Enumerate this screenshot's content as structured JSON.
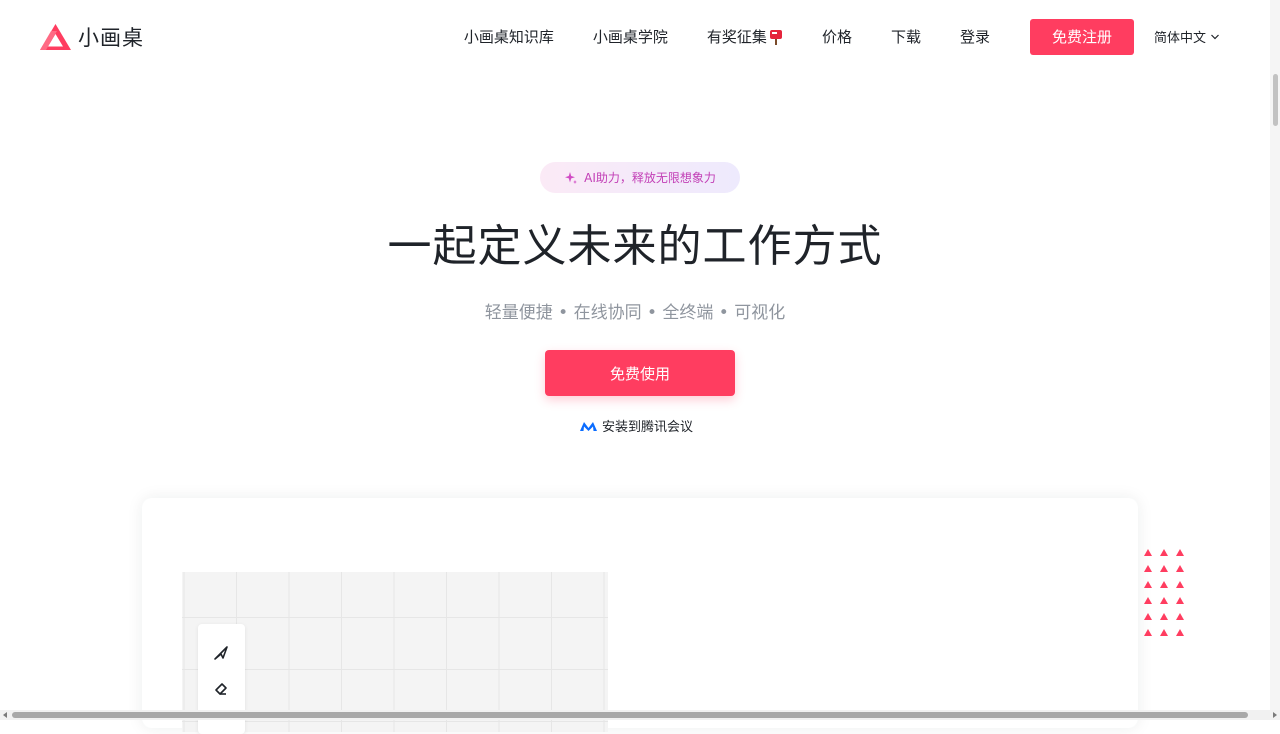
{
  "brand": {
    "name": "小画桌",
    "color": "#ff3d60"
  },
  "nav": {
    "items": [
      {
        "label": "小画桌知识库"
      },
      {
        "label": "小画桌学院"
      },
      {
        "label": "有奖征集"
      },
      {
        "label": "价格"
      },
      {
        "label": "下载"
      },
      {
        "label": "登录"
      }
    ],
    "signup_label": "免费注册",
    "language": "简体中文"
  },
  "hero": {
    "badge": "AI助力，释放无限想象力",
    "title": "一起定义未来的工作方式",
    "subtitle": "轻量便捷 • 在线协同 • 全终端 • 可视化",
    "cta_label": "免费使用",
    "tencent_link": "安装到腾讯会议"
  },
  "preview": {
    "tools": [
      "select-arrow-icon",
      "pencil-icon"
    ]
  },
  "colors": {
    "accent": "#ff3d60",
    "text": "#1f2329",
    "muted": "#8f959e",
    "badge_text": "#c23fb6",
    "tencent_blue": "#0a6cff"
  }
}
